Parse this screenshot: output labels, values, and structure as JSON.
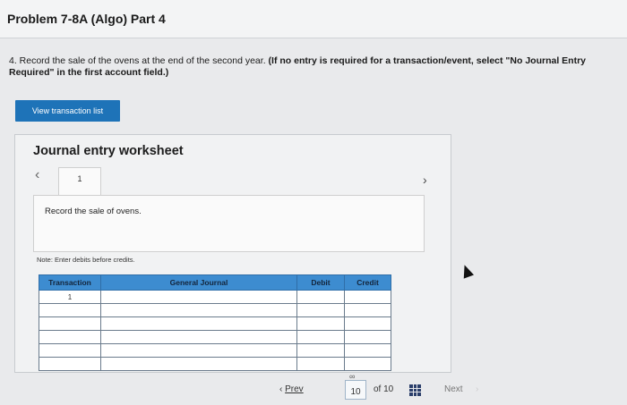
{
  "header": {
    "title": "Problem 7-8A (Algo) Part 4"
  },
  "instructions": {
    "main": "4. Record the sale of the ovens at the end of the second year.",
    "bold": "(If no entry is required for a transaction/event, select \"No Journal Entry Required\" in the first account field.)"
  },
  "buttons": {
    "view_transaction_list": "View transaction list"
  },
  "worksheet": {
    "title": "Journal entry worksheet",
    "tab_label": "1",
    "description": "Record the sale of ovens.",
    "note": "Note: Enter debits before credits.",
    "columns": [
      "Transaction",
      "General Journal",
      "Debit",
      "Credit"
    ],
    "rows": [
      {
        "transaction": "1",
        "account": "",
        "debit": "",
        "credit": ""
      },
      {
        "transaction": "",
        "account": "",
        "debit": "",
        "credit": ""
      },
      {
        "transaction": "",
        "account": "",
        "debit": "",
        "credit": ""
      },
      {
        "transaction": "",
        "account": "",
        "debit": "",
        "credit": ""
      },
      {
        "transaction": "",
        "account": "",
        "debit": "",
        "credit": ""
      },
      {
        "transaction": "",
        "account": "",
        "debit": "",
        "credit": ""
      }
    ]
  },
  "pagination": {
    "prev_label": "Prev",
    "current_page": "10",
    "of_label": "of 10",
    "next_label": "Next"
  },
  "colors": {
    "button_blue": "#1e73b8",
    "table_header_blue": "#3d8cd0"
  }
}
